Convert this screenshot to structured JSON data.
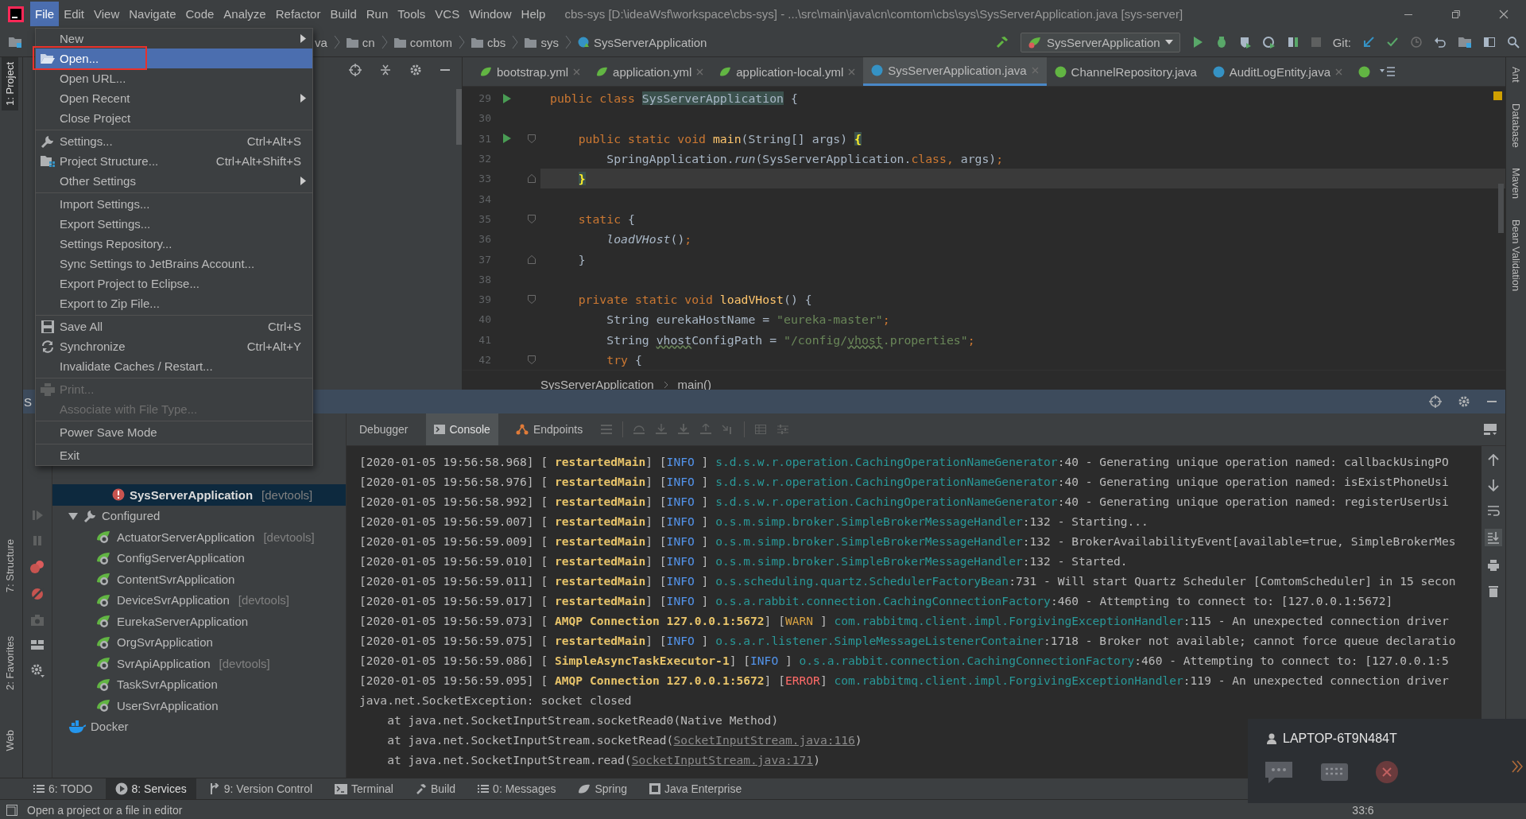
{
  "menu_bar": {
    "items": [
      {
        "label": "File",
        "selected": true
      },
      {
        "label": "Edit",
        "selected": false
      },
      {
        "label": "View",
        "selected": false
      },
      {
        "label": "Navigate",
        "selected": false
      },
      {
        "label": "Code",
        "selected": false
      },
      {
        "label": "Analyze",
        "selected": false
      },
      {
        "label": "Refactor",
        "selected": false
      },
      {
        "label": "Build",
        "selected": false
      },
      {
        "label": "Run",
        "selected": false
      },
      {
        "label": "Tools",
        "selected": false
      },
      {
        "label": "VCS",
        "selected": false
      },
      {
        "label": "Window",
        "selected": false
      },
      {
        "label": "Help",
        "selected": false
      }
    ],
    "title": "cbs-sys [D:\\ideaWsf\\workspace\\cbs-sys] - ...\\src\\main\\java\\cn\\comtom\\cbs\\sys\\SysServerApplication.java [sys-server]"
  },
  "nav_bar": {
    "breadcrumbs": [
      {
        "label": "va",
        "kind": "text"
      },
      {
        "label": "cn",
        "kind": "folder"
      },
      {
        "label": "comtom",
        "kind": "folder"
      },
      {
        "label": "cbs",
        "kind": "folder"
      },
      {
        "label": "sys",
        "kind": "folder"
      },
      {
        "label": "SysServerApplication",
        "kind": "class"
      }
    ],
    "run_config": "SysServerApplication",
    "git_label": "Git:"
  },
  "left_strip": [
    {
      "label": "1: Project",
      "selected": true
    },
    {
      "label": "7: Structure",
      "selected": false
    },
    {
      "label": "2: Favorites",
      "selected": false
    },
    {
      "label": "Web",
      "selected": false
    }
  ],
  "right_strip": [
    "Ant",
    "Database",
    "Maven",
    "Bean Validation"
  ],
  "file_menu": [
    {
      "kind": "plain",
      "label": "New",
      "submenu": true,
      "selected": false,
      "disabled": false,
      "outlined": false
    },
    {
      "kind": "folder",
      "label": "Open...",
      "submenu": false,
      "selected": true,
      "disabled": false,
      "outlined": true
    },
    {
      "kind": "plain",
      "label": "Open URL...",
      "submenu": false,
      "selected": false,
      "disabled": false,
      "outlined": false
    },
    {
      "kind": "plain",
      "label": "Open Recent",
      "submenu": true,
      "selected": false,
      "disabled": false,
      "outlined": false
    },
    {
      "kind": "plain",
      "label": "Close Project",
      "submenu": false,
      "selected": false,
      "disabled": false,
      "outlined": false
    },
    {
      "kind": "separator"
    },
    {
      "kind": "wrench",
      "label": "Settings...",
      "shortcut": "Ctrl+Alt+S",
      "submenu": false,
      "selected": false,
      "disabled": false,
      "outlined": false
    },
    {
      "kind": "structure",
      "label": "Project Structure...",
      "shortcut": "Ctrl+Alt+Shift+S",
      "submenu": false,
      "selected": false,
      "disabled": false,
      "outlined": false
    },
    {
      "kind": "plain",
      "label": "Other Settings",
      "submenu": true,
      "selected": false,
      "disabled": false,
      "outlined": false
    },
    {
      "kind": "separator"
    },
    {
      "kind": "plain",
      "label": "Import Settings...",
      "submenu": false,
      "selected": false,
      "disabled": false,
      "outlined": false
    },
    {
      "kind": "plain",
      "label": "Export Settings...",
      "submenu": false,
      "selected": false,
      "disabled": false,
      "outlined": false
    },
    {
      "kind": "plain",
      "label": "Settings Repository...",
      "submenu": false,
      "selected": false,
      "disabled": false,
      "outlined": false
    },
    {
      "kind": "plain",
      "label": "Sync Settings to JetBrains Account...",
      "submenu": false,
      "selected": false,
      "disabled": false,
      "outlined": false
    },
    {
      "kind": "plain",
      "label": "Export Project to Eclipse...",
      "submenu": false,
      "selected": false,
      "disabled": false,
      "outlined": false
    },
    {
      "kind": "plain",
      "label": "Export to Zip File...",
      "submenu": false,
      "selected": false,
      "disabled": false,
      "outlined": false
    },
    {
      "kind": "separator"
    },
    {
      "kind": "save",
      "label": "Save All",
      "shortcut": "Ctrl+S",
      "submenu": false,
      "selected": false,
      "disabled": false,
      "outlined": false
    },
    {
      "kind": "sync",
      "label": "Synchronize",
      "shortcut": "Ctrl+Alt+Y",
      "submenu": false,
      "selected": false,
      "disabled": false,
      "outlined": false
    },
    {
      "kind": "plain",
      "label": "Invalidate Caches / Restart...",
      "submenu": false,
      "selected": false,
      "disabled": false,
      "outlined": false
    },
    {
      "kind": "separator"
    },
    {
      "kind": "print",
      "label": "Print...",
      "submenu": false,
      "selected": false,
      "disabled": true,
      "outlined": false
    },
    {
      "kind": "plain",
      "label": "Associate with File Type...",
      "submenu": false,
      "selected": false,
      "disabled": true,
      "outlined": false
    },
    {
      "kind": "separator"
    },
    {
      "kind": "plain",
      "label": "Power Save Mode",
      "submenu": false,
      "selected": false,
      "disabled": false,
      "outlined": false
    },
    {
      "kind": "separator"
    },
    {
      "kind": "plain",
      "label": "Exit",
      "submenu": false,
      "selected": false,
      "disabled": false,
      "outlined": false
    }
  ],
  "editor": {
    "tabs": [
      {
        "label": "bootstrap.yml",
        "kind": "yaml",
        "selected": false,
        "closable": true
      },
      {
        "label": "application.yml",
        "kind": "yaml",
        "selected": false,
        "closable": true
      },
      {
        "label": "application-local.yml",
        "kind": "yaml",
        "selected": false,
        "closable": true
      },
      {
        "label": "SysServerApplication.java",
        "kind": "class",
        "selected": true,
        "closable": true
      },
      {
        "label": "ChannelRepository.java",
        "kind": "interface",
        "selected": false,
        "closable": false
      },
      {
        "label": "AuditLogEntity.java",
        "kind": "class",
        "selected": false,
        "closable": true
      }
    ],
    "lines": [
      {
        "number": "29",
        "kind": "run",
        "current": false,
        "parts": [
          {
            "kind": "kw",
            "text": "public class "
          },
          {
            "kind": "match",
            "text": "SysServerApplication"
          },
          {
            "kind": "plain",
            "text": " {"
          }
        ]
      },
      {
        "number": "30",
        "kind": "plain",
        "current": false
      },
      {
        "number": "31",
        "kind": "run_fold",
        "current": false,
        "parts": [
          {
            "kind": "kw",
            "text": "    public static void "
          },
          {
            "kind": "decl",
            "text": "main"
          },
          {
            "kind": "plain",
            "text": "(String[] args) "
          },
          {
            "kind": "brace",
            "text": "{"
          }
        ]
      },
      {
        "number": "32",
        "kind": "plain",
        "current": false,
        "parts": [
          {
            "kind": "plain",
            "text": "        SpringApplication."
          },
          {
            "kind": "static",
            "text": "run"
          },
          {
            "kind": "plain",
            "text": "(SysServerApplication."
          },
          {
            "kind": "kw",
            "text": "class, "
          },
          {
            "kind": "plain",
            "text": "args)"
          },
          {
            "kind": "kw",
            "text": ";"
          }
        ]
      },
      {
        "number": "33",
        "kind": "fold_end",
        "current": true,
        "parts": [
          {
            "kind": "brace",
            "text": "    }"
          }
        ]
      },
      {
        "number": "34",
        "kind": "plain",
        "current": false
      },
      {
        "number": "35",
        "kind": "fold",
        "current": false,
        "parts": [
          {
            "kind": "kw",
            "text": "    static"
          },
          {
            "kind": "plain",
            "text": " {"
          }
        ]
      },
      {
        "number": "36",
        "kind": "plain",
        "current": false,
        "parts": [
          {
            "kind": "static",
            "text": "        loadVHost"
          },
          {
            "kind": "plain",
            "text": "()"
          },
          {
            "kind": "kw",
            "text": ";"
          }
        ]
      },
      {
        "number": "37",
        "kind": "fold_end",
        "current": false,
        "parts": [
          {
            "kind": "plain",
            "text": "    }"
          }
        ]
      },
      {
        "number": "38",
        "kind": "plain",
        "current": false
      },
      {
        "number": "39",
        "kind": "fold",
        "current": false,
        "parts": [
          {
            "kind": "kw",
            "text": "    private static void "
          },
          {
            "kind": "decl",
            "text": "loadVHost"
          },
          {
            "kind": "plain",
            "text": "() {"
          }
        ]
      },
      {
        "number": "40",
        "kind": "plain",
        "current": false,
        "parts": [
          {
            "kind": "plain",
            "text": "        String eurekaHostName = "
          },
          {
            "kind": "string",
            "text": "\"eureka-master\""
          },
          {
            "kind": "kw",
            "text": ";"
          }
        ]
      },
      {
        "number": "41",
        "kind": "plain",
        "current": false,
        "parts": [
          {
            "kind": "plain",
            "text": "        String "
          },
          {
            "kind": "typo",
            "text": "vhost"
          },
          {
            "kind": "plain",
            "text": "ConfigPath = "
          },
          {
            "kind": "string",
            "text": "\"/config/"
          },
          {
            "kind": "typo_string",
            "text": "vhost"
          },
          {
            "kind": "string",
            "text": ".properties\""
          },
          {
            "kind": "kw",
            "text": ";"
          }
        ]
      },
      {
        "number": "42",
        "kind": "fold",
        "current": false,
        "parts": [
          {
            "kind": "kw",
            "text": "        try"
          },
          {
            "kind": "plain",
            "text": " {"
          }
        ]
      }
    ],
    "breadcrumbs": [
      "SysServerApplication",
      "main()"
    ]
  },
  "services": {
    "title": "S",
    "tree": [
      {
        "label": "SysServerApplication",
        "tag": "[devtools]",
        "kind": "error_app",
        "selected": true
      },
      {
        "label": "Configured",
        "kind": "group",
        "selected": false,
        "expanded": true,
        "children": [
          {
            "label": "ActuatorServerApplication",
            "tag": "[devtools]",
            "kind": "app",
            "selected": false
          },
          {
            "label": "ConfigServerApplication",
            "kind": "app",
            "selected": false
          },
          {
            "label": "ContentSvrApplication",
            "kind": "app",
            "selected": false
          },
          {
            "label": "DeviceSvrApplication",
            "tag": "[devtools]",
            "kind": "app",
            "selected": false
          },
          {
            "label": "EurekaServerApplication",
            "kind": "app",
            "selected": false
          },
          {
            "label": "OrgSvrApplication",
            "kind": "app",
            "selected": false
          },
          {
            "label": "SvrApiApplication",
            "tag": "[devtools]",
            "kind": "app",
            "selected": false
          },
          {
            "label": "TaskSvrApplication",
            "kind": "app",
            "selected": false
          },
          {
            "label": "UserSvrApplication",
            "kind": "app",
            "selected": false
          }
        ]
      },
      {
        "label": "Docker",
        "kind": "docker",
        "selected": false
      }
    ],
    "console_tabs": [
      {
        "label": "Debugger",
        "kind": "text",
        "selected": false
      },
      {
        "label": "Console",
        "kind": "console",
        "selected": true
      },
      {
        "label": "Endpoints",
        "kind": "endpoints",
        "selected": false
      }
    ],
    "console": [
      {
        "parts": [
          {
            "kind": "plain",
            "text": "[2020-01-05 19:56:58.968] [ "
          },
          {
            "kind": "thread",
            "text": "restartedMain"
          },
          {
            "kind": "plain",
            "text": "] ["
          },
          {
            "kind": "info",
            "text": "INFO "
          },
          {
            "kind": "plain",
            "text": "] "
          },
          {
            "kind": "logger",
            "text": "s.d.s.w.r.operation.CachingOperationNameGenerator"
          },
          {
            "kind": "plain",
            "text": ":40 - Generating unique operation named: callbackUsingPO"
          }
        ]
      },
      {
        "parts": [
          {
            "kind": "plain",
            "text": "[2020-01-05 19:56:58.976] [ "
          },
          {
            "kind": "thread",
            "text": "restartedMain"
          },
          {
            "kind": "plain",
            "text": "] ["
          },
          {
            "kind": "info",
            "text": "INFO "
          },
          {
            "kind": "plain",
            "text": "] "
          },
          {
            "kind": "logger",
            "text": "s.d.s.w.r.operation.CachingOperationNameGenerator"
          },
          {
            "kind": "plain",
            "text": ":40 - Generating unique operation named: isExistPhoneUsi"
          }
        ]
      },
      {
        "parts": [
          {
            "kind": "plain",
            "text": "[2020-01-05 19:56:58.992] [ "
          },
          {
            "kind": "thread",
            "text": "restartedMain"
          },
          {
            "kind": "plain",
            "text": "] ["
          },
          {
            "kind": "info",
            "text": "INFO "
          },
          {
            "kind": "plain",
            "text": "] "
          },
          {
            "kind": "logger",
            "text": "s.d.s.w.r.operation.CachingOperationNameGenerator"
          },
          {
            "kind": "plain",
            "text": ":40 - Generating unique operation named: registerUserUsi"
          }
        ]
      },
      {
        "parts": [
          {
            "kind": "plain",
            "text": "[2020-01-05 19:56:59.007] [ "
          },
          {
            "kind": "thread",
            "text": "restartedMain"
          },
          {
            "kind": "plain",
            "text": "] ["
          },
          {
            "kind": "info",
            "text": "INFO "
          },
          {
            "kind": "plain",
            "text": "] "
          },
          {
            "kind": "logger",
            "text": "o.s.m.simp.broker.SimpleBrokerMessageHandler"
          },
          {
            "kind": "plain",
            "text": ":132 - Starting..."
          }
        ]
      },
      {
        "parts": [
          {
            "kind": "plain",
            "text": "[2020-01-05 19:56:59.009] [ "
          },
          {
            "kind": "thread",
            "text": "restartedMain"
          },
          {
            "kind": "plain",
            "text": "] ["
          },
          {
            "kind": "info",
            "text": "INFO "
          },
          {
            "kind": "plain",
            "text": "] "
          },
          {
            "kind": "logger",
            "text": "o.s.m.simp.broker.SimpleBrokerMessageHandler"
          },
          {
            "kind": "plain",
            "text": ":132 - BrokerAvailabilityEvent[available=true, SimpleBrokerMes"
          }
        ]
      },
      {
        "parts": [
          {
            "kind": "plain",
            "text": "[2020-01-05 19:56:59.010] [ "
          },
          {
            "kind": "thread",
            "text": "restartedMain"
          },
          {
            "kind": "plain",
            "text": "] ["
          },
          {
            "kind": "info",
            "text": "INFO "
          },
          {
            "kind": "plain",
            "text": "] "
          },
          {
            "kind": "logger",
            "text": "o.s.m.simp.broker.SimpleBrokerMessageHandler"
          },
          {
            "kind": "plain",
            "text": ":132 - Started."
          }
        ]
      },
      {
        "parts": [
          {
            "kind": "plain",
            "text": "[2020-01-05 19:56:59.011] [ "
          },
          {
            "kind": "thread",
            "text": "restartedMain"
          },
          {
            "kind": "plain",
            "text": "] ["
          },
          {
            "kind": "info",
            "text": "INFO "
          },
          {
            "kind": "plain",
            "text": "] "
          },
          {
            "kind": "logger",
            "text": "o.s.scheduling.quartz.SchedulerFactoryBean"
          },
          {
            "kind": "plain",
            "text": ":731 - Will start Quartz Scheduler [ComtomScheduler] in 15 secon"
          }
        ]
      },
      {
        "parts": [
          {
            "kind": "plain",
            "text": "[2020-01-05 19:56:59.017] [ "
          },
          {
            "kind": "thread",
            "text": "restartedMain"
          },
          {
            "kind": "plain",
            "text": "] ["
          },
          {
            "kind": "info",
            "text": "INFO "
          },
          {
            "kind": "plain",
            "text": "] "
          },
          {
            "kind": "logger",
            "text": "o.s.a.rabbit.connection.CachingConnectionFactory"
          },
          {
            "kind": "plain",
            "text": ":460 - Attempting to connect to: [127.0.0.1:5672]"
          }
        ]
      },
      {
        "parts": [
          {
            "kind": "plain",
            "text": "[2020-01-05 19:56:59.073] [ "
          },
          {
            "kind": "thread",
            "text": "AMQP Connection 127.0.0.1:5672"
          },
          {
            "kind": "plain",
            "text": "] ["
          },
          {
            "kind": "warn",
            "text": "WARN "
          },
          {
            "kind": "plain",
            "text": "] "
          },
          {
            "kind": "logger",
            "text": "com.rabbitmq.client.impl.ForgivingExceptionHandler"
          },
          {
            "kind": "plain",
            "text": ":115 - An unexpected connection driver"
          }
        ]
      },
      {
        "parts": [
          {
            "kind": "plain",
            "text": "[2020-01-05 19:56:59.075] [ "
          },
          {
            "kind": "thread",
            "text": "restartedMain"
          },
          {
            "kind": "plain",
            "text": "] ["
          },
          {
            "kind": "info",
            "text": "INFO "
          },
          {
            "kind": "plain",
            "text": "] "
          },
          {
            "kind": "logger",
            "text": "o.s.a.r.listener.SimpleMessageListenerContainer"
          },
          {
            "kind": "plain",
            "text": ":1718 - Broker not available; cannot force queue declaratio"
          }
        ]
      },
      {
        "parts": [
          {
            "kind": "plain",
            "text": "[2020-01-05 19:56:59.086] [ "
          },
          {
            "kind": "thread",
            "text": "SimpleAsyncTaskExecutor-1"
          },
          {
            "kind": "plain",
            "text": "] ["
          },
          {
            "kind": "info",
            "text": "INFO "
          },
          {
            "kind": "plain",
            "text": "] "
          },
          {
            "kind": "logger",
            "text": "o.s.a.rabbit.connection.CachingConnectionFactory"
          },
          {
            "kind": "plain",
            "text": ":460 - Attempting to connect to: [127.0.0.1:5"
          }
        ]
      },
      {
        "parts": [
          {
            "kind": "plain",
            "text": "[2020-01-05 19:56:59.095] [ "
          },
          {
            "kind": "thread",
            "text": "AMQP Connection 127.0.0.1:5672"
          },
          {
            "kind": "plain",
            "text": "] ["
          },
          {
            "kind": "error",
            "text": "ERROR"
          },
          {
            "kind": "plain",
            "text": "] "
          },
          {
            "kind": "logger",
            "text": "com.rabbitmq.client.impl.ForgivingExceptionHandler"
          },
          {
            "kind": "plain",
            "text": ":119 - An unexpected connection driver"
          }
        ]
      },
      {
        "parts": [
          {
            "kind": "plain",
            "text": "java.net.SocketException: socket closed"
          }
        ]
      },
      {
        "parts": [
          {
            "kind": "plain",
            "text": "    at java.net.SocketInputStream.socketRead0(Native Method)"
          }
        ]
      },
      {
        "parts": [
          {
            "kind": "plain",
            "text": "    at java.net.SocketInputStream.socketRead("
          },
          {
            "kind": "link",
            "text": "SocketInputStream.java:116"
          },
          {
            "kind": "plain",
            "text": ")"
          }
        ]
      },
      {
        "parts": [
          {
            "kind": "plain",
            "text": "    at java.net.SocketInputStream.read("
          },
          {
            "kind": "link",
            "text": "SocketInputStream.java:171"
          },
          {
            "kind": "plain",
            "text": ")"
          }
        ]
      }
    ]
  },
  "bottom_tabs": [
    {
      "label": "6: TODO",
      "kind": "list",
      "selected": false
    },
    {
      "label": "8: Services",
      "kind": "services",
      "selected": true
    },
    {
      "label": "9: Version Control",
      "kind": "vcs",
      "selected": false
    },
    {
      "label": "Terminal",
      "kind": "terminal",
      "selected": false
    },
    {
      "label": "Build",
      "kind": "hammer",
      "selected": false
    },
    {
      "label": "0: Messages",
      "kind": "list",
      "selected": false
    },
    {
      "label": "Spring",
      "kind": "leaf",
      "selected": false
    },
    {
      "label": "Java Enterprise",
      "kind": "enterprise",
      "selected": false
    }
  ],
  "status_bar": {
    "message": "Open a project or a file in editor",
    "position": "33:6"
  },
  "notification": {
    "device": "LAPTOP-6T9N484T"
  }
}
